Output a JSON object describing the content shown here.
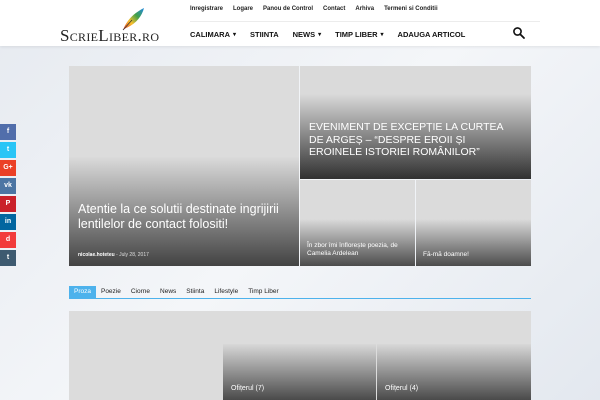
{
  "site": {
    "logo_text": "ScrieLiber.ro"
  },
  "top_links": [
    "Inregistrare",
    "Logare",
    "Panou de Control",
    "Contact",
    "Arhiva",
    "Termeni si Conditii"
  ],
  "main_nav": [
    {
      "label": "CALIMARA",
      "has_dropdown": true
    },
    {
      "label": "STIINTA",
      "has_dropdown": false
    },
    {
      "label": "NEWS",
      "has_dropdown": true
    },
    {
      "label": "TIMP LIBER",
      "has_dropdown": true
    },
    {
      "label": "ADAUGA ARTICOL",
      "has_dropdown": false
    }
  ],
  "hero": {
    "main": {
      "title": "Atentie la ce solutii destinate ingrijirii lentilelor de contact folositi!",
      "author": "nicolae.hoteteu",
      "date": "July 28, 2017"
    },
    "top_right": {
      "title": "EVENIMENT DE EXCEPȚIE LA CURTEA DE ARGEȘ – “DESPRE EROII ȘI EROINELE ISTORIEI ROMÂNILOR”"
    },
    "small1": {
      "title": "În zbor îmi înflorește poezia, de Camelia Ardelean"
    },
    "small2": {
      "title": "Fă-mă doamne!"
    }
  },
  "tabs": [
    {
      "label": "Proza",
      "active": true
    },
    {
      "label": "Poezie",
      "active": false
    },
    {
      "label": "Ciorne",
      "active": false
    },
    {
      "label": "News",
      "active": false
    },
    {
      "label": "Stiinta",
      "active": false
    },
    {
      "label": "Lifestyle",
      "active": false
    },
    {
      "label": "Timp Liber",
      "active": false
    }
  ],
  "lower": {
    "mid_caption": "Ofițerul (7)",
    "right_caption": "Ofițerul (4)"
  },
  "social": [
    {
      "name": "facebook",
      "glyph": "f",
      "color": "#516eab"
    },
    {
      "name": "twitter",
      "glyph": "t",
      "color": "#29c5f6"
    },
    {
      "name": "google-plus",
      "glyph": "G+",
      "color": "#eb4026"
    },
    {
      "name": "vk",
      "glyph": "vk",
      "color": "#4c75a3"
    },
    {
      "name": "pinterest",
      "glyph": "P",
      "color": "#ca212a"
    },
    {
      "name": "linkedin",
      "glyph": "in",
      "color": "#0266a0"
    },
    {
      "name": "delicious",
      "glyph": "d",
      "color": "#f23b3b"
    },
    {
      "name": "tumblr",
      "glyph": "t",
      "color": "#3e5a70"
    }
  ],
  "colors": {
    "accent": "#4db2ec"
  },
  "icons": {
    "search": "search-icon",
    "quill": "quill-logo-icon"
  }
}
